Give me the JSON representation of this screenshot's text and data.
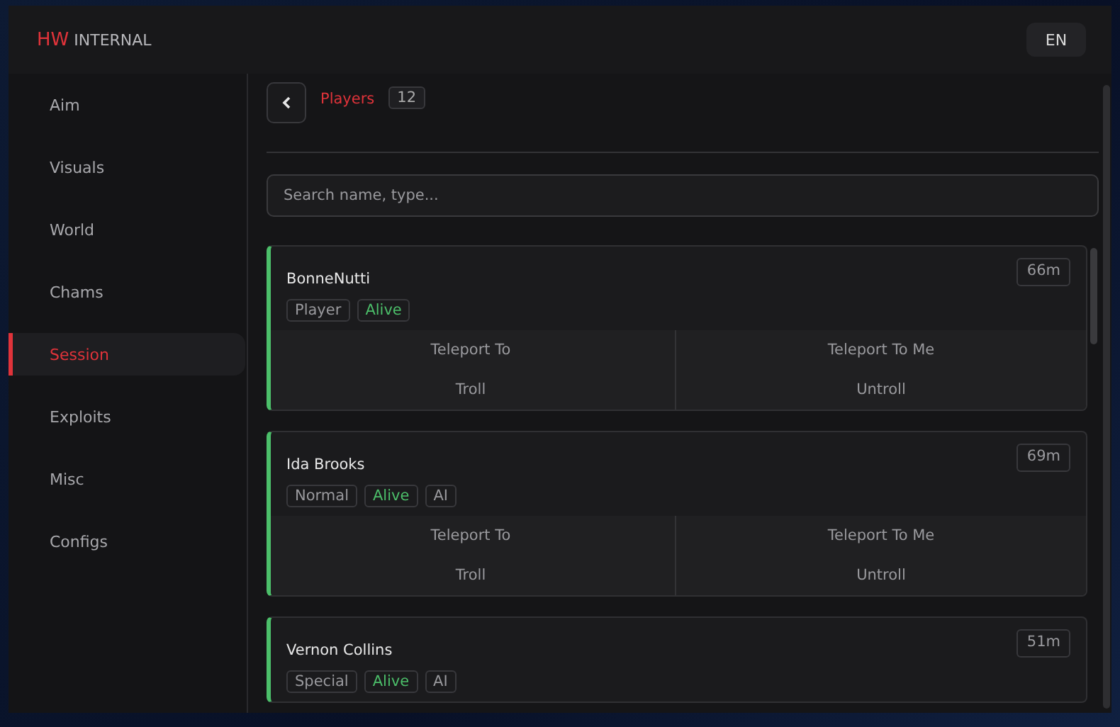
{
  "header": {
    "brand_accent": "HW",
    "brand_rest": "INTERNAL",
    "language": "EN"
  },
  "sidebar": {
    "items": [
      {
        "label": "Aim",
        "selected": false
      },
      {
        "label": "Visuals",
        "selected": false
      },
      {
        "label": "World",
        "selected": false
      },
      {
        "label": "Chams",
        "selected": false
      },
      {
        "label": "Session",
        "selected": true
      },
      {
        "label": "Exploits",
        "selected": false
      },
      {
        "label": "Misc",
        "selected": false
      },
      {
        "label": "Configs",
        "selected": false
      }
    ]
  },
  "content": {
    "title": "Players",
    "count": "12",
    "search": {
      "placeholder": "Search name, type..."
    },
    "players": [
      {
        "name": "BonneNutti",
        "distance": "66m",
        "tags": [
          {
            "label": "Player",
            "highlight": false
          },
          {
            "label": "Alive",
            "highlight": true
          }
        ],
        "actions": [
          "Teleport To",
          "Teleport To Me",
          "Troll",
          "Untroll"
        ]
      },
      {
        "name": "Ida Brooks",
        "distance": "69m",
        "tags": [
          {
            "label": "Normal",
            "highlight": false
          },
          {
            "label": "Alive",
            "highlight": true
          },
          {
            "label": "AI",
            "highlight": false
          }
        ],
        "actions": [
          "Teleport To",
          "Teleport To Me",
          "Troll",
          "Untroll"
        ]
      },
      {
        "name": "Vernon Collins",
        "distance": "51m",
        "tags": [
          {
            "label": "Special",
            "highlight": false
          },
          {
            "label": "Alive",
            "highlight": true
          },
          {
            "label": "AI",
            "highlight": false
          }
        ]
      }
    ]
  }
}
